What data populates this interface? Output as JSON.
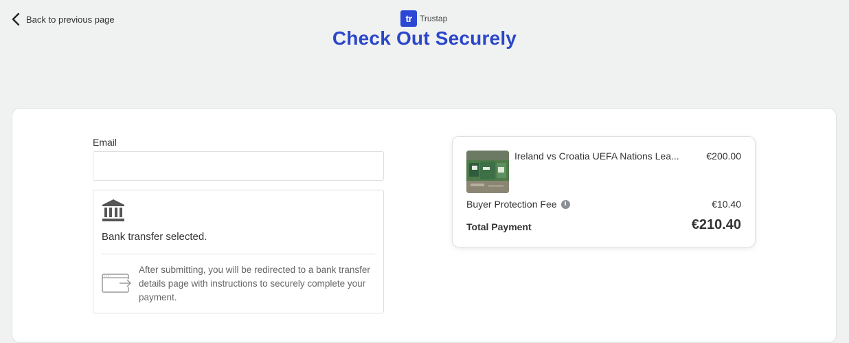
{
  "header": {
    "back_label": "Back to previous page",
    "brand_mark": "tr",
    "brand_name": "Trustap",
    "title": "Check Out Securely"
  },
  "form": {
    "email_label": "Email",
    "email_value": "",
    "email_placeholder": "",
    "bank_selected_text": "Bank transfer selected.",
    "redirect_text": "After submitting, you will be redirected to a bank transfer details page with instructions to securely complete your payment."
  },
  "summary": {
    "item_title": "Ireland vs Croatia UEFA Nations Lea...",
    "item_price": "€200.00",
    "fee_label": "Buyer Protection Fee",
    "fee_info_glyph": "i",
    "fee_price": "€10.40",
    "total_label": "Total Payment",
    "total_price": "€210.40"
  },
  "colors": {
    "accent": "#2b47c9",
    "brand": "#2b47d6",
    "background": "#f0f1f1"
  },
  "icons": {
    "back": "chevron-left-icon",
    "bank": "bank-icon",
    "redirect": "browser-redirect-icon",
    "info": "info-icon"
  }
}
